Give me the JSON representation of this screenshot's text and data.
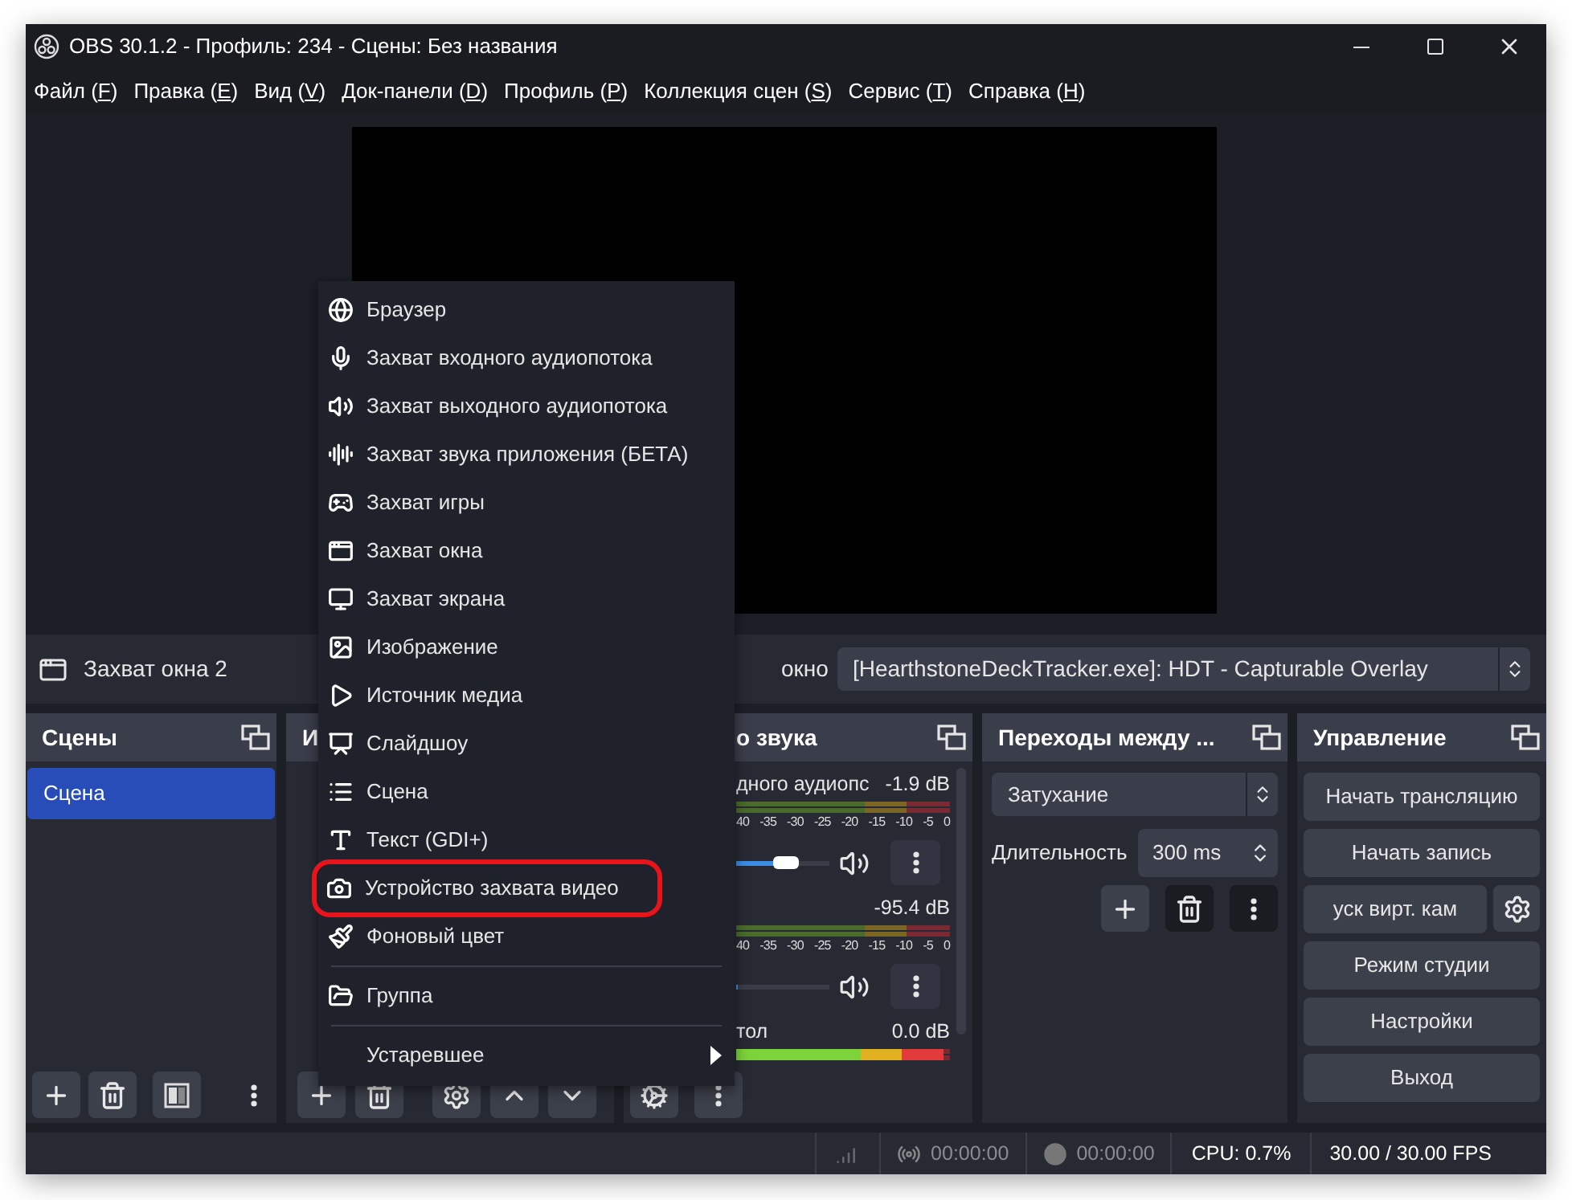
{
  "window": {
    "title": "OBS 30.1.2 - Профиль: 234 - Сцены: Без названия"
  },
  "menu_bar": [
    {
      "before": "Файл (",
      "key": "F",
      "after": ")"
    },
    {
      "before": "Правка (",
      "key": "E",
      "after": ")"
    },
    {
      "before": "Вид (",
      "key": "V",
      "after": ")"
    },
    {
      "before": "Док-панели (",
      "key": "D",
      "after": ")"
    },
    {
      "before": "Профиль (",
      "key": "P",
      "after": ")"
    },
    {
      "before": "Коллекция сцен (",
      "key": "S",
      "after": ")"
    },
    {
      "before": "Сервис (",
      "key": "T",
      "after": ")"
    },
    {
      "before": "Справка (",
      "key": "H",
      "after": ")"
    }
  ],
  "properties_bar": {
    "source": "Захват окна 2",
    "field_label": "окно",
    "window_value": "[HearthstoneDeckTracker.exe]: HDT - Capturable Overlay"
  },
  "scenes": {
    "title": "Сцены",
    "items": [
      {
        "label": "Сцена",
        "selected": true
      }
    ]
  },
  "sources": {
    "title": "И"
  },
  "mixer": {
    "title": "о звука",
    "channels": [
      {
        "name": "дного аудиопс",
        "reading": "-1.9 dB",
        "scale": [
          "40",
          "-35",
          "-30",
          "-25",
          "-20",
          "-15",
          "-10",
          "-5",
          "0"
        ],
        "volume": {
          "level": 0.55
        }
      },
      {
        "reading": "-95.4 dB",
        "scale": [
          "40",
          "-35",
          "-30",
          "-25",
          "-20",
          "-15",
          "-10",
          "-5",
          "0"
        ],
        "volume": {
          "level": 0
        }
      },
      {
        "name": "тол",
        "reading": "0.0 dB",
        "meter": {
          "level": 0.97
        }
      }
    ]
  },
  "transitions": {
    "title": "Переходы между ...",
    "transition": "Затухание",
    "duration_label": "Длительность",
    "duration": "300 ms"
  },
  "controls": {
    "title": "Управление",
    "buttons": [
      {
        "label": "Начать трансляцию",
        "kind": "wide"
      },
      {
        "label": "Начать запись",
        "kind": "wide"
      },
      {
        "label": "уск вирт. кам",
        "kind": "with-settings"
      },
      {
        "label": "Режим студии",
        "kind": "wide"
      },
      {
        "label": "Настройки",
        "kind": "wide"
      },
      {
        "label": "Выход",
        "kind": "wide"
      }
    ]
  },
  "status_bar": {
    "stream_time": "00:00:00",
    "record_time": "00:00:00",
    "cpu": "CPU: 0.7%",
    "fps": "30.00 / 30.00 FPS"
  },
  "context_menu": {
    "items": [
      {
        "label": "Браузер",
        "highlighted": false
      },
      {
        "label": "Захват входного аудиопотока",
        "highlighted": false
      },
      {
        "label": "Захват выходного аудиопотока",
        "highlighted": false
      },
      {
        "label": "Захват звука приложения (БЕТА)",
        "highlighted": false
      },
      {
        "label": "Захват игры",
        "highlighted": false
      },
      {
        "label": "Захват окна",
        "highlighted": false
      },
      {
        "label": "Захват экрана",
        "highlighted": false
      },
      {
        "label": "Изображение",
        "highlighted": false
      },
      {
        "label": "Источник медиа",
        "highlighted": false
      },
      {
        "label": "Слайдшоу",
        "highlighted": false
      },
      {
        "label": "Сцена",
        "highlighted": false
      },
      {
        "label": "Текст (GDI+)",
        "highlighted": false
      },
      {
        "label": "Устройство захвата видео",
        "highlighted": true
      },
      {
        "label": "Фоновый цвет",
        "highlighted": false
      },
      {
        "label": "Группа",
        "highlighted": false,
        "separator_before": true
      },
      {
        "label": "Устаревшее",
        "highlighted": false,
        "separator_before": true,
        "submenu": true
      }
    ]
  }
}
